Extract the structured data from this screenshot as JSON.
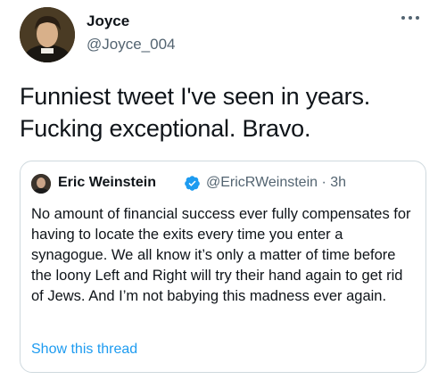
{
  "author": {
    "name": "Joyce",
    "handle": "@Joyce_004"
  },
  "tweet": {
    "text": "Funniest tweet I've seen in years. Fucking exceptional. Bravo."
  },
  "quoted_tweet": {
    "name": "Eric Weinstein",
    "handle": "@EricRWeinstein",
    "separator": "·",
    "time": "3h",
    "body": "No amount of financial success ever fully compensates for having to locate the exits every time you enter a synagogue. We all know it’s only a matter of time before the loony Left and Right will try their hand again to get rid of Jews. And I’m not babying this madness ever again.",
    "show_thread_label": "Show this thread"
  },
  "icons": {
    "more": "more-horizontal-icon",
    "verified": "verified-badge-icon"
  },
  "colors": {
    "link": "#1d9bf0",
    "secondary_text": "#536471",
    "border": "#cfd9de"
  }
}
